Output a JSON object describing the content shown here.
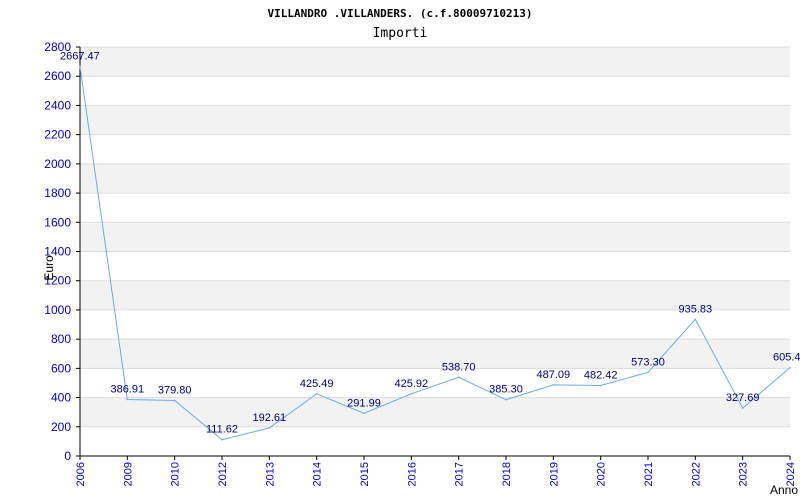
{
  "chart_data": {
    "type": "line",
    "title": "VILLANDRO .VILLANDERS. (c.f.80009710213)",
    "subtitle": "Importi",
    "xlabel": "Anno",
    "ylabel": "Euro",
    "ylim": [
      0,
      2800
    ],
    "yticks": [
      0,
      200,
      400,
      600,
      800,
      1000,
      1200,
      1400,
      1600,
      1800,
      2000,
      2200,
      2400,
      2600,
      2800
    ],
    "grid": true,
    "categories": [
      "2006",
      "2009",
      "2010",
      "2012",
      "2013",
      "2014",
      "2015",
      "2016",
      "2017",
      "2018",
      "2019",
      "2020",
      "2021",
      "2022",
      "2023",
      "2024"
    ],
    "values": [
      2667.47,
      386.91,
      379.8,
      111.62,
      192.61,
      425.49,
      291.99,
      425.92,
      538.7,
      385.3,
      487.09,
      482.42,
      573.3,
      935.83,
      327.69,
      605.4
    ],
    "value_labels": [
      "2667.47",
      "386.91",
      "379.80",
      "111.62",
      "192.61",
      "425.49",
      "291.99",
      "425.92",
      "538.70",
      "385.30",
      "487.09",
      "482.42",
      "573.30",
      "935.83",
      "327.69",
      "605.4"
    ],
    "colors": {
      "line": "#6aaaf0",
      "band_alt": "#f2f2f2",
      "band": "#ffffff",
      "grid": "#dcdcdc",
      "tick_text": "#0000cc",
      "value_text": "#000080"
    }
  }
}
